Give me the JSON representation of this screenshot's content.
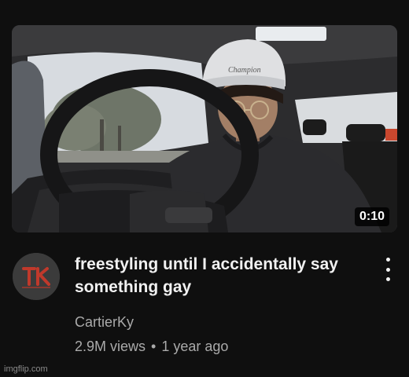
{
  "video": {
    "title": "freestyling until I accidentally say something gay",
    "duration": "0:10",
    "channel": "CartierKy",
    "views": "2.9M views",
    "separator": "•",
    "age": "1 year ago"
  },
  "thumbnail": {
    "beanie_brand": "Champion"
  },
  "avatar": {
    "initials": "TK",
    "accent": "#c0392b"
  },
  "menu": {
    "icon": "more-vert-icon"
  },
  "watermark": "imgflip.com",
  "colors": {
    "background": "#0f0f0f",
    "primary_text": "#f1f1f1",
    "secondary_text": "#aaaaaa"
  }
}
